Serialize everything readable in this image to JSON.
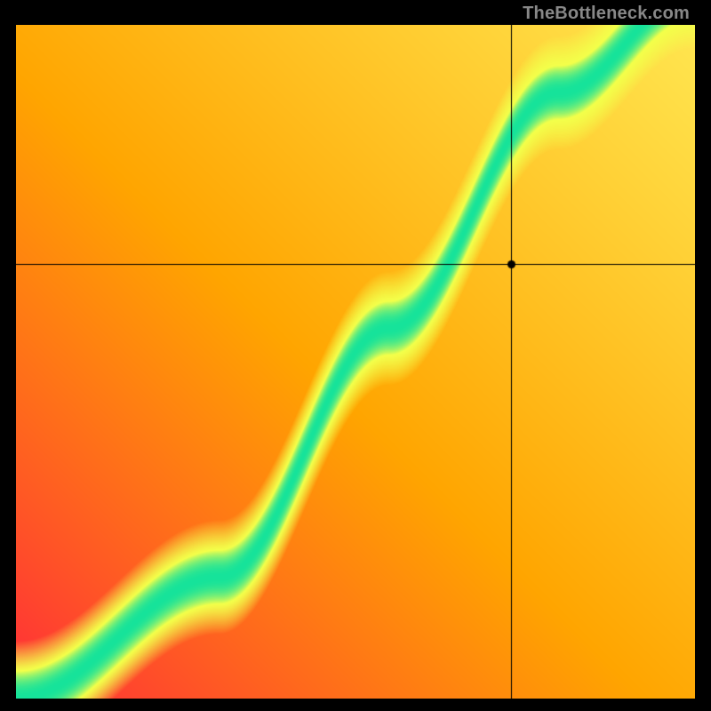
{
  "watermark": "TheBottleneck.com",
  "chart_data": {
    "type": "heatmap",
    "title": "",
    "xlabel": "",
    "ylabel": "",
    "xlim": [
      0,
      1
    ],
    "ylim": [
      0,
      1
    ],
    "crosshair": {
      "x": 0.73,
      "y": 0.645
    },
    "marker": {
      "x": 0.73,
      "y": 0.645
    },
    "curve_control_points": [
      {
        "x": 0.0,
        "y": 0.0
      },
      {
        "x": 0.3,
        "y": 0.18
      },
      {
        "x": 0.55,
        "y": 0.55
      },
      {
        "x": 0.8,
        "y": 0.9
      },
      {
        "x": 1.0,
        "y": 1.05
      }
    ],
    "band_half_width": 0.04,
    "soft_half_width": 0.085,
    "background_gradient_angle_deg": 45,
    "colors": {
      "hot_low": "#ff2a3a",
      "hot_mid": "#ffa500",
      "hot_high": "#ffe650",
      "band_edge": "#f3ff4a",
      "band_core": "#16e39a"
    },
    "grid": false,
    "legend": false
  }
}
